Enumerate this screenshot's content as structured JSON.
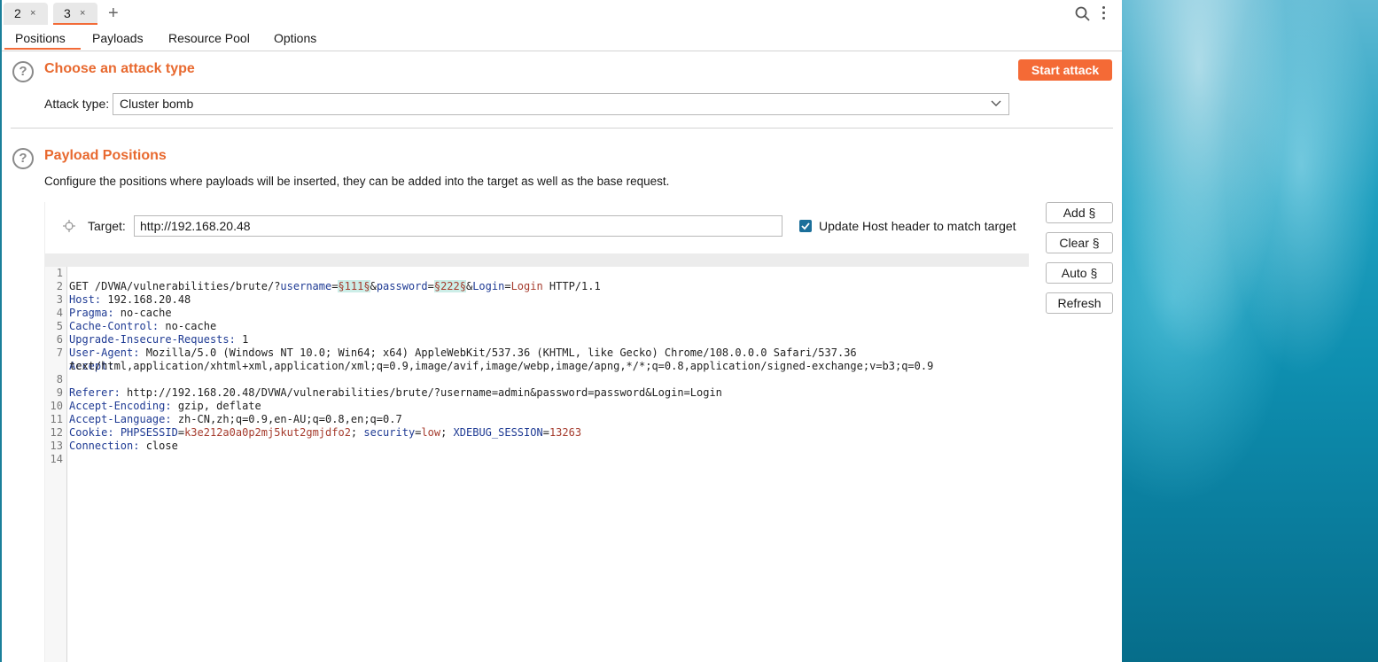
{
  "tabs": [
    {
      "label": "2",
      "close": "×"
    },
    {
      "label": "3",
      "close": "×"
    }
  ],
  "new_tab": "+",
  "subtabs": [
    "Positions",
    "Payloads",
    "Resource Pool",
    "Options"
  ],
  "attack_section": {
    "title": "Choose an attack type",
    "start_button": "Start attack",
    "attack_type_label": "Attack type:",
    "attack_type_value": "Cluster bomb"
  },
  "positions_section": {
    "title": "Payload Positions",
    "description": "Configure the positions where payloads will be inserted, they can be added into the target as well as the base request.",
    "target_label": "Target:",
    "target_value": "http://192.168.20.48",
    "update_host_label": "Update Host header to match target",
    "update_host_checked": true
  },
  "side_buttons": [
    "Add §",
    "Clear §",
    "Auto §",
    "Refresh"
  ],
  "request_lines": {
    "l1": {
      "n": "1",
      "a": "GET /DVWA/vulnerabilities/brute/?",
      "b": "username",
      "c": "=",
      "d": "§111§",
      "e": "&",
      "f": "password",
      "g": "=",
      "h": "§222§",
      "i": "&",
      "j": "Login",
      "k": "=",
      "l": "Login",
      "m": " HTTP/1.1"
    },
    "l2": {
      "n": "2",
      "k": "Host:",
      "v": " 192.168.20.48"
    },
    "l3": {
      "n": "3",
      "k": "Pragma:",
      "v": " no-cache"
    },
    "l4": {
      "n": "4",
      "k": "Cache-Control:",
      "v": " no-cache"
    },
    "l5": {
      "n": "5",
      "k": "Upgrade-Insecure-Requests:",
      "v": " 1"
    },
    "l6": {
      "n": "6",
      "k": "User-Agent:",
      "v": " Mozilla/5.0 (Windows NT 10.0; Win64; x64) AppleWebKit/537.36 (KHTML, like Gecko) Chrome/108.0.0.0 Safari/537.36"
    },
    "l7": {
      "n": "7",
      "k": "Accept:",
      "v": ""
    },
    "l7b": {
      "v": "text/html,application/xhtml+xml,application/xml;q=0.9,image/avif,image/webp,image/apng,*/*;q=0.8,application/signed-exchange;v=b3;q=0.9"
    },
    "l8": {
      "n": "8",
      "k": "Referer:",
      "v": " http://192.168.20.48/DVWA/vulnerabilities/brute/?username=admin&password=password&Login=Login"
    },
    "l9": {
      "n": "9",
      "k": "Accept-Encoding:",
      "v": " gzip, deflate"
    },
    "l10": {
      "n": "10",
      "k": "Accept-Language:",
      "v": " zh-CN,zh;q=0.9,en-AU;q=0.8,en;q=0.7"
    },
    "l11": {
      "n": "11",
      "k": "Cookie:",
      "p1": "PHPSESSID",
      "e1": "=",
      "v1": "k3e212a0a0p2mj5kut2gmjdfo2",
      "s1": "; ",
      "p2": "security",
      "e2": "=",
      "v2": "low",
      "s2": "; ",
      "p3": "XDEBUG_SESSION",
      "e3": "=",
      "v3": "13263"
    },
    "l12": {
      "n": "12",
      "k": "Connection:",
      "v": " close"
    },
    "l13": {
      "n": "13"
    },
    "l14": {
      "n": "14"
    }
  },
  "icons": [
    "search-icon",
    "more-icon",
    "help-icon",
    "crosshair-icon",
    "chevron-down-icon",
    "check-icon"
  ]
}
